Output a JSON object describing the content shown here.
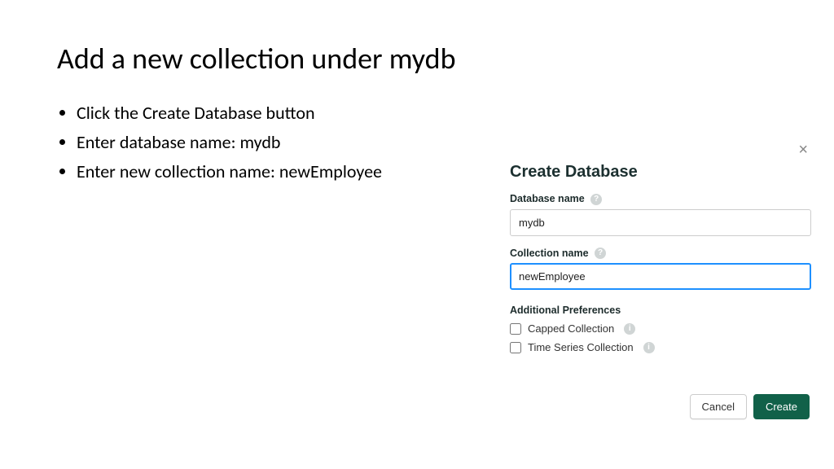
{
  "slide": {
    "title": "Add a new collection under mydb",
    "bullets": [
      "Click the Create Database button",
      "Enter database name: mydb",
      "Enter new collection name: newEmployee"
    ]
  },
  "dialog": {
    "title": "Create Database",
    "db_label": "Database name",
    "db_value": "mydb",
    "coll_label": "Collection name",
    "coll_value": "newEmployee",
    "prefs_label": "Additional Preferences",
    "opt_capped": "Capped Collection",
    "opt_timeseries": "Time Series Collection",
    "cancel_label": "Cancel",
    "create_label": "Create"
  }
}
